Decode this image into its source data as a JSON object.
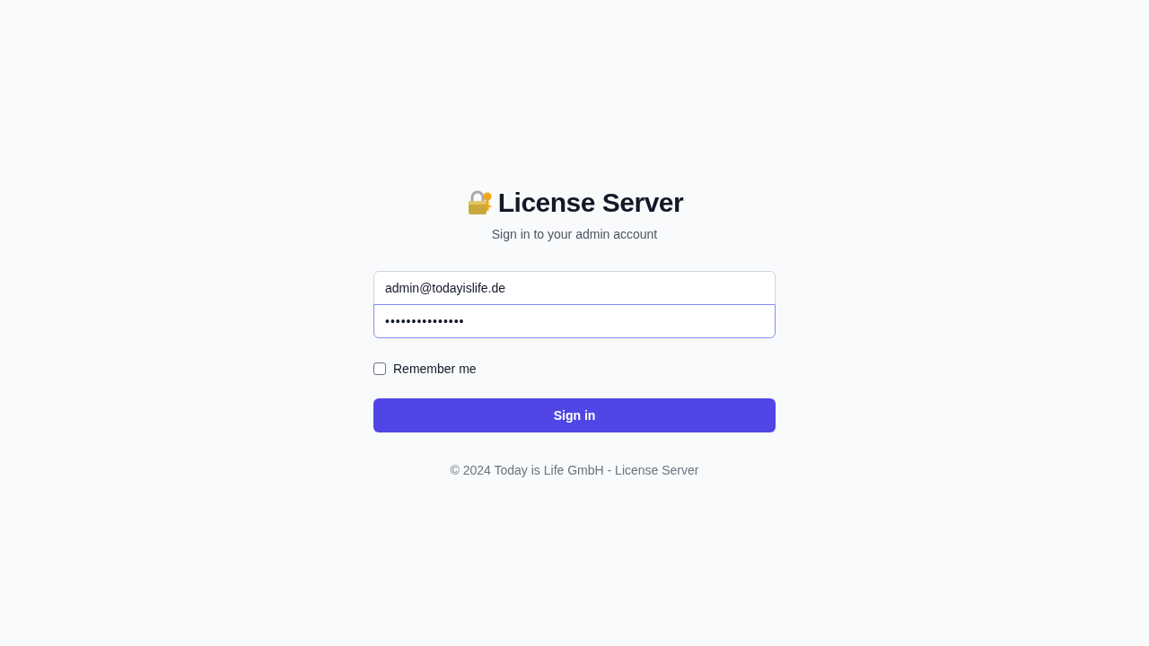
{
  "header": {
    "title": "License Server",
    "subtitle": "Sign in to your admin account"
  },
  "fields": [
    {
      "kind": "email",
      "value": "admin@todayislife.de",
      "focused": false
    },
    {
      "kind": "password",
      "value": "•••••••••••••••",
      "focused": true
    }
  ],
  "remember": {
    "label": "Remember me",
    "checked": false
  },
  "submit": {
    "label": "Sign in"
  },
  "footer": "© 2024 Today is Life GmbH - License Server"
}
